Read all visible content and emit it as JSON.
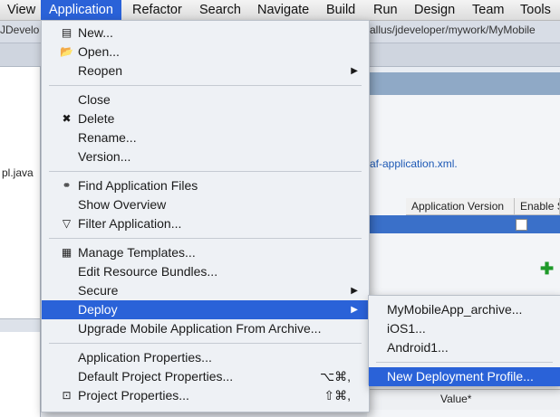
{
  "menubar": {
    "items": [
      "View",
      "Application",
      "Refactor",
      "Search",
      "Navigate",
      "Build",
      "Run",
      "Design",
      "Team",
      "Tools"
    ],
    "active_index": 1
  },
  "background": {
    "title_fragment": "JDevelo",
    "path_fragment": "allus/jdeveloper/mywork/MyMobile",
    "left_file": "pl.java",
    "link_fragment": "af-application.xml.",
    "table_headers": [
      "Application Version",
      "Enable S"
    ],
    "value_header": "Value*"
  },
  "app_menu": {
    "items": [
      {
        "label": "New...",
        "icon": "new-icon",
        "glyph": "▤"
      },
      {
        "label": "Open...",
        "icon": "folder-icon",
        "glyph": "📂"
      },
      {
        "label": "Reopen",
        "submenu": true
      },
      {
        "separator": true
      },
      {
        "label": "Close"
      },
      {
        "label": "Delete",
        "icon": "delete-icon",
        "glyph": "✖"
      },
      {
        "label": "Rename..."
      },
      {
        "label": "Version..."
      },
      {
        "separator": true
      },
      {
        "label": "Find Application Files",
        "icon": "binoculars-icon",
        "glyph": "⚭"
      },
      {
        "label": "Show Overview"
      },
      {
        "label": "Filter Application...",
        "icon": "filter-icon",
        "glyph": "▽"
      },
      {
        "separator": true
      },
      {
        "label": "Manage Templates...",
        "icon": "templates-icon",
        "glyph": "▦"
      },
      {
        "label": "Edit Resource Bundles..."
      },
      {
        "label": "Secure",
        "submenu": true
      },
      {
        "label": "Deploy",
        "submenu": true,
        "highlighted": true
      },
      {
        "label": "Upgrade Mobile Application From Archive..."
      },
      {
        "separator": true
      },
      {
        "label": "Application Properties..."
      },
      {
        "label": "Default Project Properties...",
        "shortcut": "⌥⌘,"
      },
      {
        "label": "Project Properties...",
        "icon": "project-properties-icon",
        "glyph": "⊡",
        "shortcut": "⇧⌘,"
      }
    ]
  },
  "deploy_submenu": {
    "items": [
      {
        "label": "MyMobileApp_archive..."
      },
      {
        "label": "iOS1..."
      },
      {
        "label": "Android1..."
      },
      {
        "separator": true
      },
      {
        "label": "New Deployment Profile...",
        "highlighted": true
      }
    ]
  },
  "colors": {
    "highlight": "#2a62d8",
    "menu_bg": "#eef1f5"
  }
}
